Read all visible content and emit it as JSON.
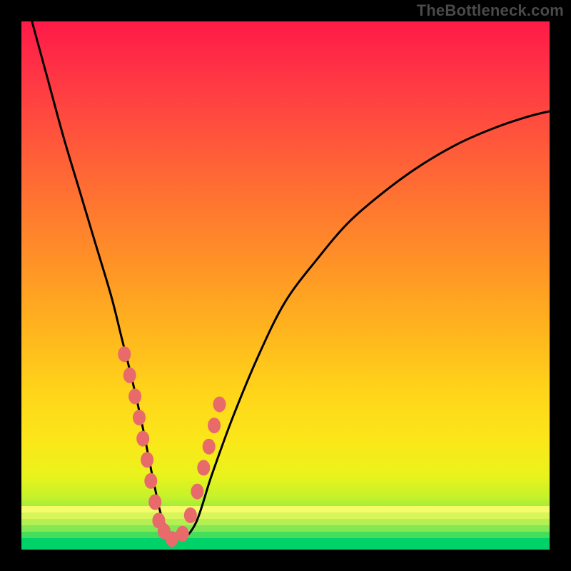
{
  "watermark": {
    "text": "TheBottleneck.com"
  },
  "colors": {
    "frame_bg": "#000000",
    "curve_stroke": "#000000",
    "marker_fill": "#e86a6a",
    "gradient_top": "#ff1a47",
    "gradient_bottom": "#00d26a"
  },
  "chart_data": {
    "type": "line",
    "title": "",
    "xlabel": "",
    "ylabel": "",
    "xlim": [
      0,
      100
    ],
    "ylim": [
      0,
      100
    ],
    "series": [
      {
        "name": "bottleneck-curve",
        "x": [
          2,
          5,
          8,
          11,
          14,
          17,
          19,
          21,
          23,
          25,
          27,
          30,
          33,
          36,
          40,
          45,
          50,
          56,
          62,
          69,
          76,
          83,
          90,
          96,
          100
        ],
        "values": [
          100,
          89,
          78,
          68,
          58,
          48,
          40,
          32,
          23,
          13,
          5,
          2,
          5,
          14,
          25,
          37,
          47,
          55,
          62,
          68,
          73,
          77,
          80,
          82,
          83
        ]
      }
    ],
    "markers": {
      "name": "highlighted-points",
      "x": [
        19.5,
        20.5,
        21.5,
        22.3,
        23.0,
        23.8,
        24.5,
        25.3,
        26.0,
        27.0,
        28.5,
        30.5,
        32.0,
        33.3,
        34.5,
        35.5,
        36.5,
        37.5
      ],
      "values": [
        37.0,
        33.0,
        29.0,
        25.0,
        21.0,
        17.0,
        13.0,
        9.0,
        5.5,
        3.5,
        2.0,
        3.0,
        6.5,
        11.0,
        15.5,
        19.5,
        23.5,
        27.5
      ]
    },
    "bottom_stripes": [
      {
        "color": "#f6fb6a",
        "height_pct": 1.2
      },
      {
        "color": "#d8f55a",
        "height_pct": 1.2
      },
      {
        "color": "#b4ef54",
        "height_pct": 1.2
      },
      {
        "color": "#84e754",
        "height_pct": 1.2
      },
      {
        "color": "#44dd5c",
        "height_pct": 1.2
      },
      {
        "color": "#00d26a",
        "height_pct": 2.2
      }
    ]
  }
}
